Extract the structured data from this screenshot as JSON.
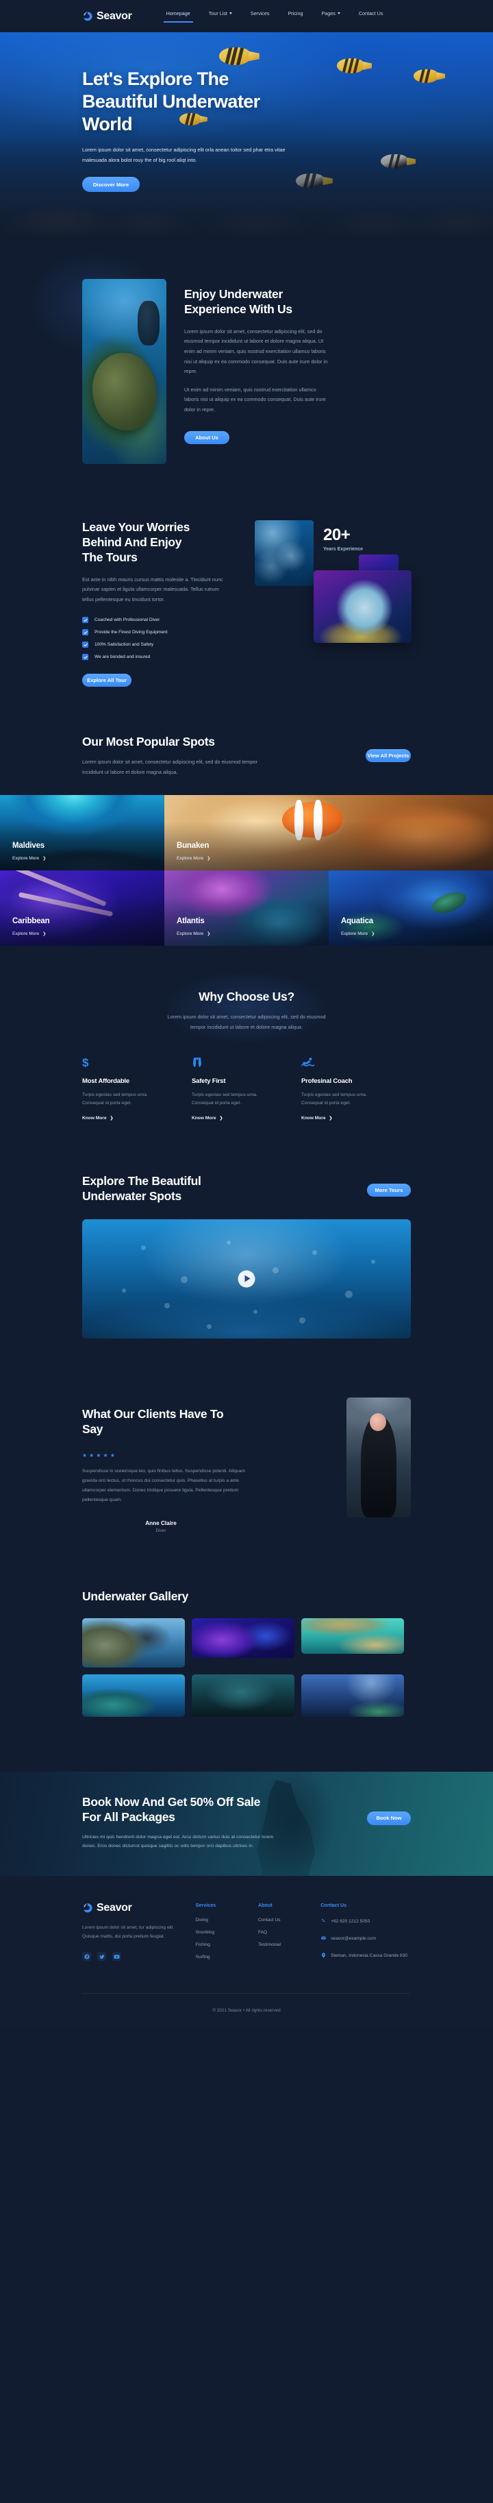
{
  "brand": {
    "name": "Seavor",
    "logo_icon": "wave-droplet-logo-icon"
  },
  "nav": {
    "items": [
      {
        "label": "Homepage",
        "active": true,
        "has_caret": false
      },
      {
        "label": "Tour List",
        "active": false,
        "has_caret": true
      },
      {
        "label": "Services",
        "active": false,
        "has_caret": false
      },
      {
        "label": "Pricing",
        "active": false,
        "has_caret": false
      },
      {
        "label": "Pages",
        "active": false,
        "has_caret": true
      },
      {
        "label": "Contact Us",
        "active": false,
        "has_caret": false
      }
    ]
  },
  "hero": {
    "title": "Let's Explore The Beautiful Underwater World",
    "body": "Lorem ipsum dolor sit amet, consectetur adipiscing elit orla anean toitor sed phar etra vitae malesuada alora bolot rouy the of big rool aliqt into.",
    "cta": "Discover More"
  },
  "enjoy": {
    "title": "Enjoy Underwater Experience With Us",
    "body1": "Lorem ipsum dolor sit amet, consectetur adipiscing elit, sed do eiusmod tempor incididunt ut labore et dolore magna aliqua. Ut enim ad minim veniam, quis nostrud exercitation ullamco laboris nisi ut aliquip ex ea commodo consequat. Duis aute irure dolor in repre.",
    "body2": "Ut enim ad minim veniam, quis nostrud exercitation ullamco laboris nisi ut aliquip ex ea commodo consequat. Duis aute irure dolor in repre.",
    "cta": "About Us",
    "image_alt": "scuba-diver-with-sea-turtle-photo"
  },
  "worries": {
    "title": "Leave Your Worries Behind And Enjoy The Tours",
    "body": "Est ante in nibh mauris cursus mattis molestie a. Tincidunt nunc pulvinar sapien et ligula ullamcorper malesuada. Tellus rutrum tellus pellentesque eu tincidunt tortor.",
    "checklist": [
      "Coached with Professional Diver",
      "Provide the Finest Diving Equipment",
      "100% Satisfaction and Safety",
      "We are bonded and insured"
    ],
    "cta": "Explore All Tour",
    "stat_number": "20+",
    "stat_label": "Years Experience"
  },
  "spots": {
    "title": "Our Most Popular Spots",
    "body": "Lorem ipsum dolor sit amet, consectetur adipiscing elit, sed do eiusmod tempor incididunt ut labore et dolore magna aliqua.",
    "cta": "View All Projects",
    "link_label": "Explore More",
    "items": [
      {
        "name": "Maldives"
      },
      {
        "name": "Bunaken"
      },
      {
        "name": "Caribbean"
      },
      {
        "name": "Atlantis"
      },
      {
        "name": "Aquatica"
      }
    ]
  },
  "why": {
    "title": "Why Choose Us?",
    "body": "Lorem ipsum dolor sit amet, consectetur adipiscing elit, sed do eiusmod tempor incididunt ut labore et dolore magna aliqua.",
    "link_label": "Know More",
    "cards": [
      {
        "icon": "dollar-sign-icon",
        "title": "Most Affordable",
        "body": "Turpis egestas sed tempus urna. Consequat id porta eget."
      },
      {
        "icon": "life-vest-icon",
        "title": "Safety First",
        "body": "Turpis egestas sed tempus urna. Consequat id porta eget."
      },
      {
        "icon": "swimmer-icon",
        "title": "Profesinal Coach",
        "body": "Turpis egestas sed tempus urna. Consequat id porta eget."
      }
    ]
  },
  "video": {
    "title": "Explore The Beautiful Underwater Spots",
    "cta": "More Tours",
    "play_icon": "play-icon"
  },
  "testimonial": {
    "title": "What Our Clients Have To Say",
    "rating": 5,
    "quote": "Suspendisse in scelerisque leo, quis finibus tellus. Suspendisse potenti. Aliquam gravida orci lectus, ut rhoncus dui consectetur quis. Phasellus at turpis a ante ullamcorper elementum. Donec tristique posuere ligula. Pellentesque pretium pellentesque quam.",
    "author_name": "Anne Claire",
    "author_role": "Diver"
  },
  "gallery": {
    "title": "Underwater Gallery",
    "items": [
      {
        "alt": "diver-with-coral-reef"
      },
      {
        "alt": "purple-coral-reef-at-night"
      },
      {
        "alt": "snorkeler-in-turquoise-water"
      },
      {
        "alt": "diver-and-sea-turtle"
      },
      {
        "alt": "group-of-divers-in-gear"
      },
      {
        "alt": "penguin-swimming-underwater"
      }
    ]
  },
  "cta": {
    "title": "Book Now And Get 50% Off Sale For All Packages",
    "body": "Ultricies mi quis hendrerit dolor magna eget est. Arcu dictum varius duis at consectetur lorem donec. Eros donec dictumst quisque sagittis oc odio tempor orci dapibus ultrices in.",
    "button": "Book Now"
  },
  "footer": {
    "brand_text": "Lorem ipsum dolor sit amet, tur adipiscing elit. Quisque mattis, dui porta pretium feugiat.",
    "socials": [
      {
        "name": "facebook-icon"
      },
      {
        "name": "twitter-icon"
      },
      {
        "name": "youtube-icon"
      }
    ],
    "columns": [
      {
        "heading": "Services",
        "links": [
          "Diving",
          "Snorkling",
          "Fishing",
          "Surfing"
        ]
      },
      {
        "heading": "About",
        "links": [
          "Contact Us",
          "FAQ",
          "Testimonial"
        ]
      }
    ],
    "contact": {
      "heading": "Contact Us",
      "phone": "+62 820 1212 5050",
      "email": "seavor@example.com",
      "address": "Sleman, Indonesia Cassa Grande 830",
      "phone_icon": "phone-icon",
      "email_icon": "envelope-icon",
      "address_icon": "map-pin-icon"
    },
    "copyright": "© 2021 Seavor • All rights reserved"
  },
  "colors": {
    "accent": "#3a8bf5",
    "bg": "#111c30",
    "panel": "#121d31",
    "muted": "#93a2b8"
  }
}
